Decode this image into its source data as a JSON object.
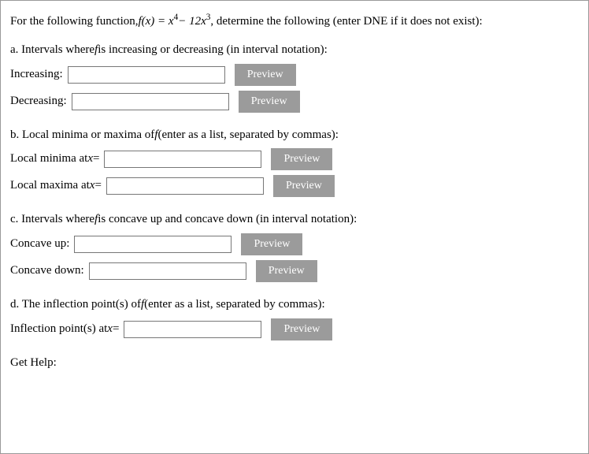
{
  "problem": {
    "intro_prefix": "For the following function, ",
    "func_lhs": "f(x) = x",
    "exp1": "4",
    "mid": " − 12x",
    "exp2": "3",
    "intro_suffix": ", determine the following (enter DNE if it does not exist):"
  },
  "parts": {
    "a": {
      "title_prefix": "a. Intervals where ",
      "title_mid": "f",
      "title_suffix": " is increasing or decreasing (in interval notation):",
      "increasing_label": "Increasing:",
      "decreasing_label": "Decreasing:"
    },
    "b": {
      "title_prefix": "b. Local minima or maxima of ",
      "title_mid": "f",
      "title_suffix": " (enter as a list, separated by commas):",
      "minima_prefix": "Local minima at ",
      "maxima_prefix": "Local maxima at ",
      "eq": " ="
    },
    "c": {
      "title_prefix": "c. Intervals where ",
      "title_mid": "f",
      "title_suffix": " is concave up and concave down (in interval notation):",
      "up_label": "Concave up:",
      "down_label": "Concave down:"
    },
    "d": {
      "title_prefix": "d. The inflection point(s) of ",
      "title_mid": "f",
      "title_suffix": " (enter as a list, separated by commas):",
      "infl_prefix": "Inflection point(s) at ",
      "eq": " ="
    }
  },
  "buttons": {
    "preview": "Preview"
  },
  "footer": {
    "get_help": "Get Help:"
  },
  "inputs": {
    "increasing": "",
    "decreasing": "",
    "local_minima": "",
    "local_maxima": "",
    "concave_up": "",
    "concave_down": "",
    "inflection": ""
  },
  "var": {
    "x": "x"
  }
}
